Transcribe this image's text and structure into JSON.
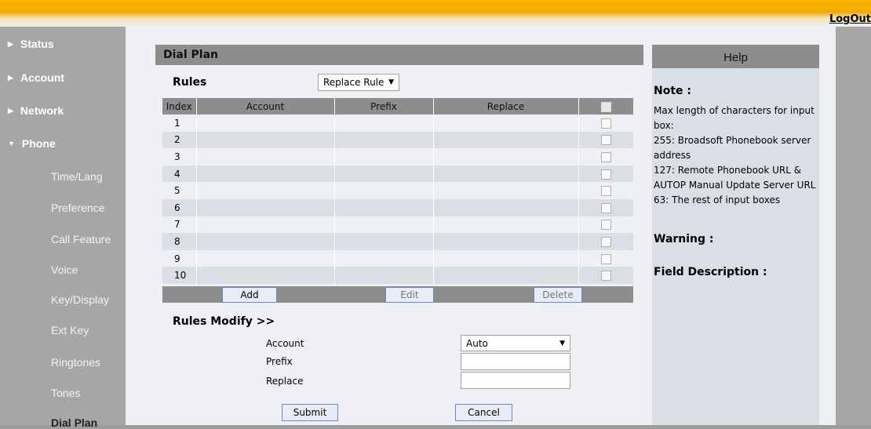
{
  "header": {
    "logout_label": "LogOut"
  },
  "sidebar": {
    "main_items": [
      {
        "label": "Status"
      },
      {
        "label": "Account"
      },
      {
        "label": "Network"
      },
      {
        "label": "Phone",
        "expanded": true
      }
    ],
    "sub_items": [
      {
        "label": "Time/Lang"
      },
      {
        "label": "Preference"
      },
      {
        "label": "Call Feature"
      },
      {
        "label": "Voice"
      },
      {
        "label": "Key/Display"
      },
      {
        "label": "Ext Key"
      },
      {
        "label": "Ringtones"
      },
      {
        "label": "Tones"
      },
      {
        "label": "Dial Plan",
        "active": true
      }
    ],
    "collapsed_icon": "triangle-right-icon",
    "expanded_icon": "triangle-down-icon"
  },
  "main": {
    "title": "Dial Plan",
    "rules_label": "Rules",
    "rule_type": {
      "selected": "Replace Rule",
      "icon": "chevron-down-icon"
    },
    "table": {
      "headers": [
        "Index",
        "Account",
        "Prefix",
        "Replace"
      ],
      "rows": [
        {
          "index": "1",
          "account": "",
          "prefix": "",
          "replace": ""
        },
        {
          "index": "2",
          "account": "",
          "prefix": "",
          "replace": ""
        },
        {
          "index": "3",
          "account": "",
          "prefix": "",
          "replace": ""
        },
        {
          "index": "4",
          "account": "",
          "prefix": "",
          "replace": ""
        },
        {
          "index": "5",
          "account": "",
          "prefix": "",
          "replace": ""
        },
        {
          "index": "6",
          "account": "",
          "prefix": "",
          "replace": ""
        },
        {
          "index": "7",
          "account": "",
          "prefix": "",
          "replace": ""
        },
        {
          "index": "8",
          "account": "",
          "prefix": "",
          "replace": ""
        },
        {
          "index": "9",
          "account": "",
          "prefix": "",
          "replace": ""
        },
        {
          "index": "10",
          "account": "",
          "prefix": "",
          "replace": ""
        }
      ]
    },
    "buttons": {
      "add": "Add",
      "edit": "Edit",
      "delete": "Delete"
    },
    "modify": {
      "title": "Rules Modify >>",
      "account_label": "Account",
      "account_value": "Auto",
      "prefix_label": "Prefix",
      "prefix_value": "",
      "replace_label": "Replace",
      "replace_value": ""
    },
    "submit_label": "Submit",
    "cancel_label": "Cancel"
  },
  "help": {
    "title": "Help",
    "note_title": "Note :",
    "note_lines": [
      "Max length of characters for input box:",
      "255: Broadsoft Phonebook server address",
      "127: Remote Phonebook URL & AUTOP Manual Update Server URL",
      "63: The rest of input boxes"
    ],
    "warning_title": "Warning :",
    "field_desc_title": "Field Description :"
  },
  "colors": {
    "accent_orange": "#f5a900",
    "sidebar_gray": "#a6a6a6",
    "header_gray": "#8d8d8d",
    "row_alt": "#d9dfe5",
    "button_border": "#6c84c8"
  }
}
